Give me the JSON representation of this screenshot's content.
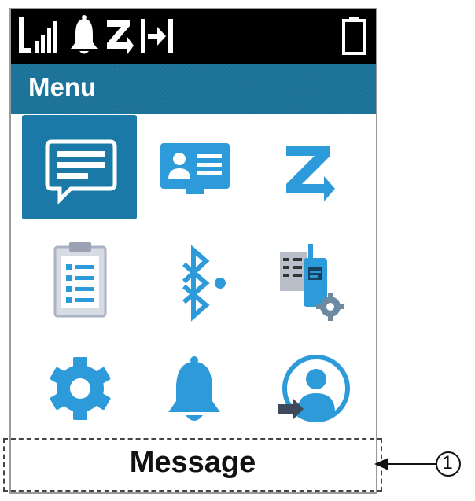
{
  "status_bar": {
    "icons": [
      "signal-strength-icon",
      "notification-bell-icon",
      "zigbee-z-icon",
      "channel-step-icon",
      "battery-icon"
    ]
  },
  "menu": {
    "title": "Menu",
    "items": [
      {
        "icon": "message-icon",
        "selected": true
      },
      {
        "icon": "contacts-icon",
        "selected": false
      },
      {
        "icon": "scan-z-icon",
        "selected": false
      },
      {
        "icon": "clipboard-list-icon",
        "selected": false
      },
      {
        "icon": "bluetooth-icon",
        "selected": false
      },
      {
        "icon": "radio-settings-icon",
        "selected": false
      },
      {
        "icon": "settings-gear-icon",
        "selected": false
      },
      {
        "icon": "alert-bell-icon",
        "selected": false
      },
      {
        "icon": "user-login-icon",
        "selected": false
      }
    ],
    "selected_label": "Message"
  },
  "callout": {
    "number": "1"
  },
  "colors": {
    "accent": "#1b7299",
    "icon_blue": "#2d9bd9",
    "status_bar": "#000000"
  }
}
